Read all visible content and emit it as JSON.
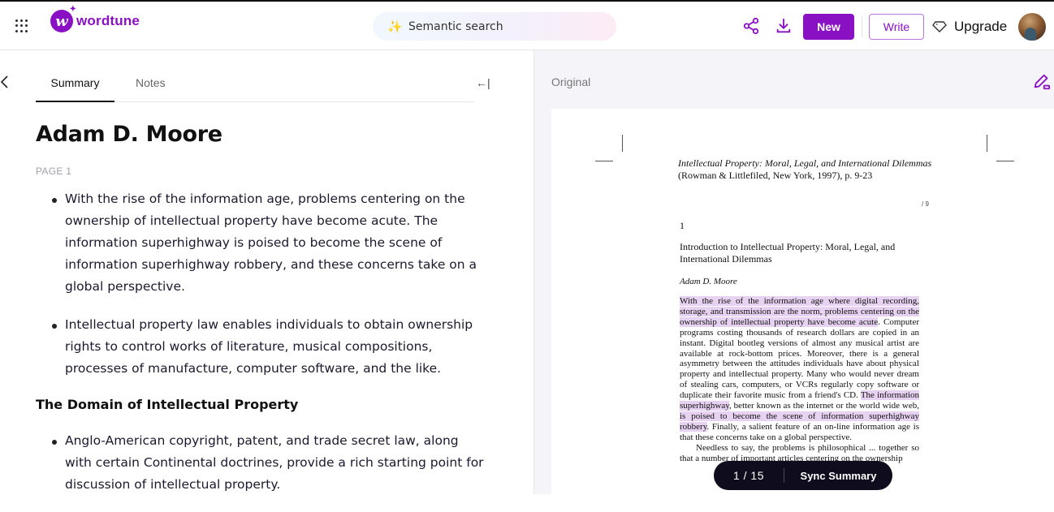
{
  "app": {
    "brand": "wordtune",
    "brand_color": "#8a10c4",
    "icons": {
      "apps": "grid-dots-icon",
      "search": "sparkle-icon",
      "share": "share-icon",
      "download": "download-icon",
      "upgrade": "diamond-icon",
      "back": "chevron-left-icon",
      "collapse": "arrow-left-bar-icon",
      "edit": "pencil-eraser-icon"
    }
  },
  "header": {
    "search_placeholder": "Semantic search",
    "new_label": "New",
    "write_label": "Write",
    "upgrade_label": "Upgrade"
  },
  "left_panel": {
    "tabs": [
      {
        "label": "Summary",
        "active": true
      },
      {
        "label": "Notes",
        "active": false
      }
    ],
    "title": "Adam D. Moore",
    "page_label": "PAGE 1",
    "bullets_1": [
      "With the rise of the information age, problems centering on the ownership of intellectual property have become acute. The information superhighway is poised to become the scene of information superhighway robbery, and these concerns take on a global perspective.",
      "Intellectual property law enables individuals to obtain ownership rights to control works of literature, musical compositions, processes of manufacture, computer software, and the like."
    ],
    "section_heading": "The Domain of Intellectual Property",
    "bullets_2": [
      "Anglo-American copyright, patent, and trade secret law, along with certain Continental doctrines, provide a rich starting point for discussion of intellectual property."
    ]
  },
  "right_panel": {
    "label": "Original",
    "document": {
      "header_italic": "Intellectual Property: Moral, Legal, and International Dilemmas",
      "header_plain": "(Rowman & Littlefiled, New York, 1997), p. 9-23",
      "page_marker": "/ 9",
      "chapter_number": "1",
      "chapter_title": "Introduction to Intellectual Property: Moral, Legal, and International Dilemmas",
      "author": "Adam D. Moore",
      "body": {
        "hl1": "With the rise of the information age where digital recording, storage, and transmission are the norm, problems centering on the ownership of intellectual property have become acute",
        "t1": ". Computer programs costing thousands of research dollars are copied in an instant. Digital bootleg versions of almost any musical artist are available at rock-bottom prices. Moreover, there is a general asymmetry between the attitudes individuals have about physical property and intellectual property. Many who would never dream of stealing cars, computers, or VCRs regularly copy software or duplicate their favorite music from a friend's CD. ",
        "hl2": "The information superhighway",
        "t2": ", better known as the internet or the world wide web, ",
        "hl3": "is poised to become the scene of information superhighway robbery",
        "t3": ". Finally, a salient feature of an on-line information age is that these concerns take on a global perspective.",
        "p2": "Needless to say, the problems is philosophical ... together so that a number of important articles centering on the ownership"
      }
    }
  },
  "pager": {
    "current": "1",
    "total": "/ 15",
    "sync_label": "Sync Summary"
  }
}
